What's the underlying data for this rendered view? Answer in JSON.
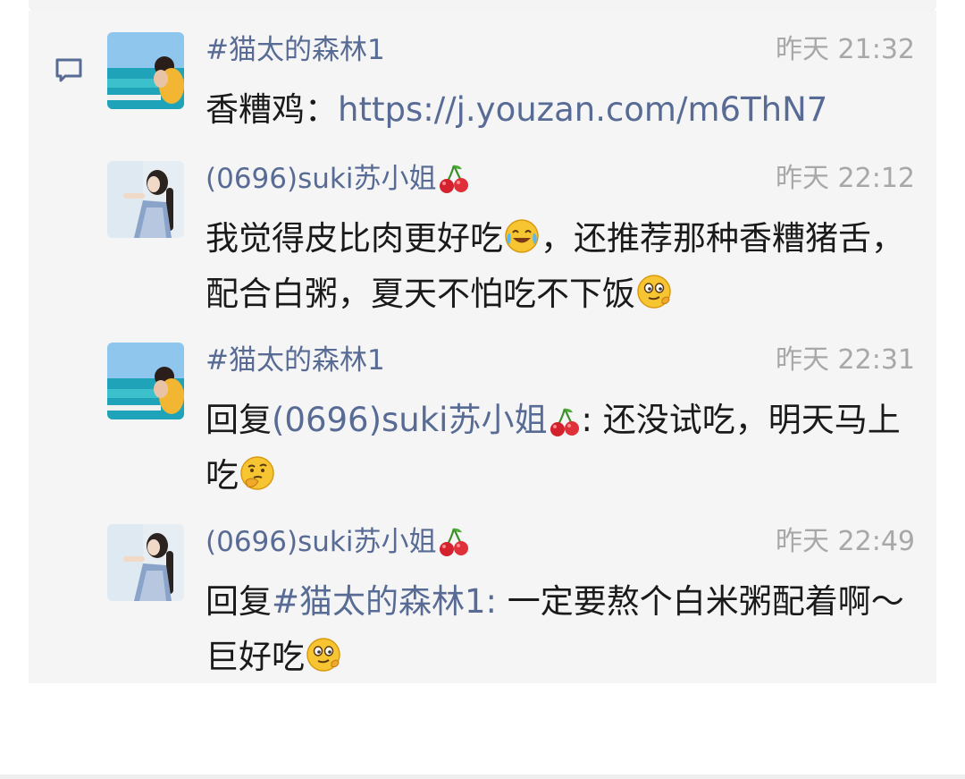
{
  "comments": [
    {
      "author": "#猫太的森林1",
      "time": "昨天 21:32",
      "text_prefix": "香糟鸡：",
      "link": "https://j.youzan.com/m6ThN7"
    },
    {
      "author": "(0696)suki苏小姐",
      "time": "昨天 22:12",
      "text_a": "我觉得皮比肉更好吃",
      "text_b": "，还推荐那种香糟猪舌，配合白粥，夏天不怕吃不下饭"
    },
    {
      "author": "#猫太的森林1",
      "time": "昨天 22:31",
      "reply_word": "回复",
      "reply_to": "(0696)suki苏小姐",
      "text": ": 还没试吃，明天马上吃"
    },
    {
      "author": "(0696)suki苏小姐",
      "time": "昨天 22:49",
      "reply_word": "回复",
      "reply_to": "#猫太的森林1:",
      "text": " 一定要熬个白米粥配着啊～巨好吃"
    }
  ],
  "icons": {
    "comments": "comment-bubble-icon",
    "emoji_laugh": "face-with-tears-of-joy-emoji",
    "emoji_cool": "smirk-face-emoji",
    "emoji_think": "thinking-face-emoji",
    "cherry": "cherry-emoji"
  },
  "colors": {
    "author": "#576b95",
    "time": "#a8a8a8",
    "text": "#1a1a1a",
    "panel": "#f5f5f5"
  }
}
